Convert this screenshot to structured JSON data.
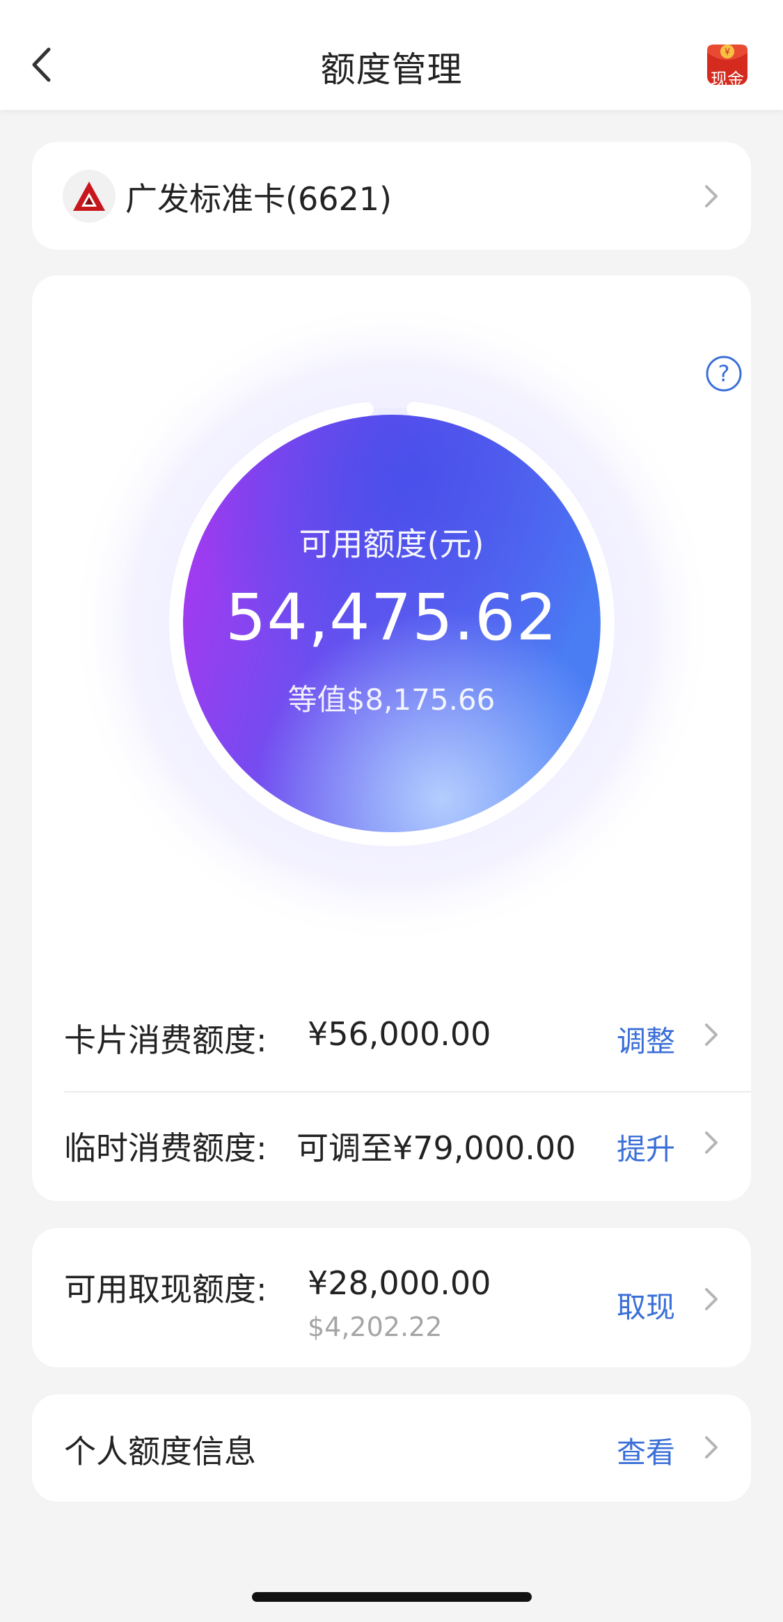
{
  "nav": {
    "title": "额度管理",
    "cash_badge": "现金",
    "icons": {
      "back": "chevron-left-icon",
      "cash": "cash-red-packet-icon"
    }
  },
  "card_select": {
    "name": "广发标准卡(6621)",
    "logo_icon": "cgb-bank-logo-icon"
  },
  "available": {
    "title": "可用额度(元)",
    "amount": "54,475.62",
    "equivalent": "等值$8,175.66",
    "used_fraction": 0.06
  },
  "consumption": {
    "label": "卡片消费额度:",
    "value": "¥56,000.00",
    "action": "调整"
  },
  "temporary": {
    "label": "临时消费额度:",
    "value": "可调至¥79,000.00",
    "action": "提升"
  },
  "cash": {
    "label": "可用取现额度:",
    "value": "¥28,000.00",
    "sub_value": "$4,202.22",
    "action": "取现"
  },
  "personal": {
    "label": "个人额度信息",
    "action": "查看"
  },
  "colors": {
    "accent": "#3a6fd8",
    "ring_purple": "#a43ae6",
    "ring_blue": "#4f6ef0"
  }
}
